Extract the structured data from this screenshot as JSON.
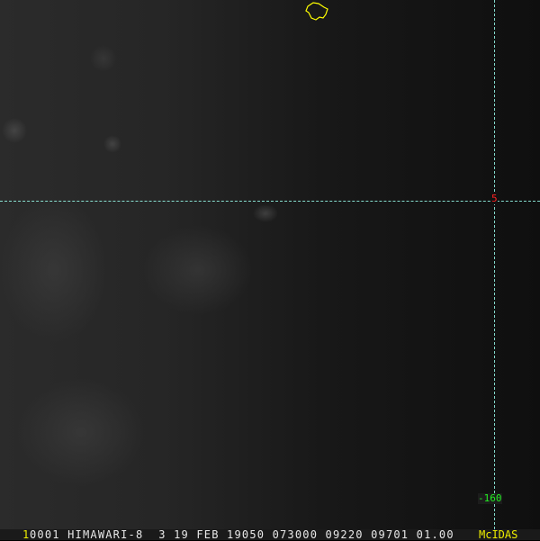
{
  "image": {
    "frame_number": "1",
    "info_line": "0001 HIMAWARI-8  3 19 FEB 19050 073000 09220 09701 01.00",
    "logo": "McIDAS",
    "latitude_label": "5",
    "longitude_label": "-160"
  },
  "colors": {
    "grid": "#99eeee",
    "lat_label": "#ff2222",
    "lon_label": "#22ee22",
    "coast": "#ffff00",
    "text": "#e8e8e8"
  }
}
